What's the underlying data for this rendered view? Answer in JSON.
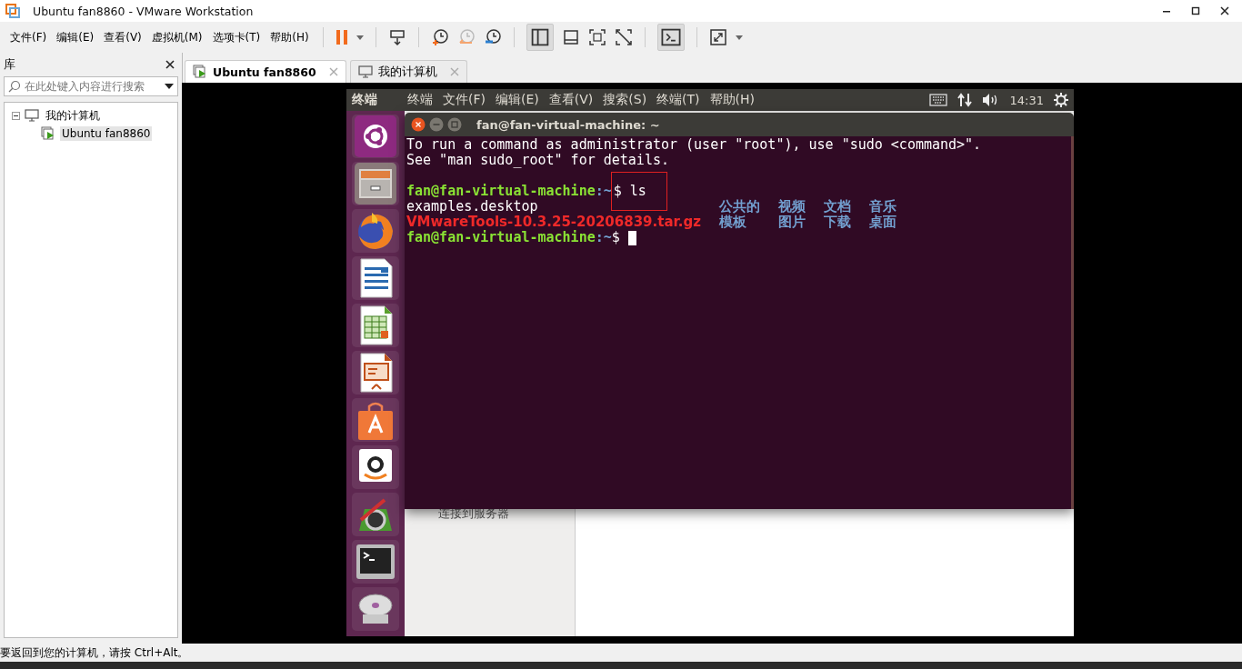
{
  "window": {
    "title": "Ubuntu fan8860 - VMware Workstation"
  },
  "menu": [
    "文件(F)",
    "编辑(E)",
    "查看(V)",
    "虚拟机(M)",
    "选项卡(T)",
    "帮助(H)"
  ],
  "library": {
    "title": "库",
    "search": {
      "placeholder": "在此处键入内容进行搜索"
    },
    "tree": [
      {
        "label": "我的计算机",
        "expanded": true,
        "selected": false,
        "children": [
          {
            "label": "Ubuntu fan8860",
            "selected": true
          }
        ]
      }
    ]
  },
  "tabs": [
    {
      "label": "Ubuntu fan8860",
      "selected": true
    },
    {
      "label": "我的计算机",
      "selected": false
    }
  ],
  "guest": {
    "top_bar": {
      "app_name": "终端",
      "menus": [
        "终端",
        "文件(F)",
        "编辑(E)",
        "查看(V)",
        "搜索(S)",
        "终端(T)",
        "帮助(H)"
      ],
      "clock": "14:31"
    },
    "background_window": {
      "sidebar_item": "连接到服务器"
    },
    "terminal": {
      "title": "fan@fan-virtual-machine: ~",
      "lines": [
        {
          "kind": "text",
          "text": "To run a command as administrator (user \"root\"), use \"sudo <command>\"."
        },
        {
          "kind": "text",
          "text": "See \"man sudo_root\" for details."
        },
        {
          "kind": "blank"
        },
        {
          "kind": "prompt",
          "user_host": "fan@fan-virtual-machine",
          "path": ":~",
          "symbol": "$",
          "command": "ls",
          "highlight": true,
          "cursor": false
        },
        {
          "kind": "listing",
          "entries": [
            {
              "name": "examples.desktop",
              "color": "#ffffff",
              "bold": false
            },
            {
              "name": "VMwareTools-10.3.25-20206839.tar.gz",
              "color": "#ef2929",
              "bold": true
            },
            {
              "name": "公共的",
              "color": "#729fcf",
              "bold": true
            },
            {
              "name": "模板",
              "color": "#729fcf",
              "bold": true
            },
            {
              "name": "视频",
              "color": "#729fcf",
              "bold": true
            },
            {
              "name": "图片",
              "color": "#729fcf",
              "bold": true
            },
            {
              "name": "文档",
              "color": "#729fcf",
              "bold": true
            },
            {
              "name": "下载",
              "color": "#729fcf",
              "bold": true
            },
            {
              "name": "音乐",
              "color": "#729fcf",
              "bold": true
            },
            {
              "name": "桌面",
              "color": "#729fcf",
              "bold": true
            }
          ]
        },
        {
          "kind": "prompt",
          "user_host": "fan@fan-virtual-machine",
          "path": ":~",
          "symbol": "$",
          "highlight": false,
          "cursor": true
        }
      ]
    }
  },
  "status_bar": {
    "text": "要返回到您的计算机，请按 Ctrl+Alt。"
  }
}
